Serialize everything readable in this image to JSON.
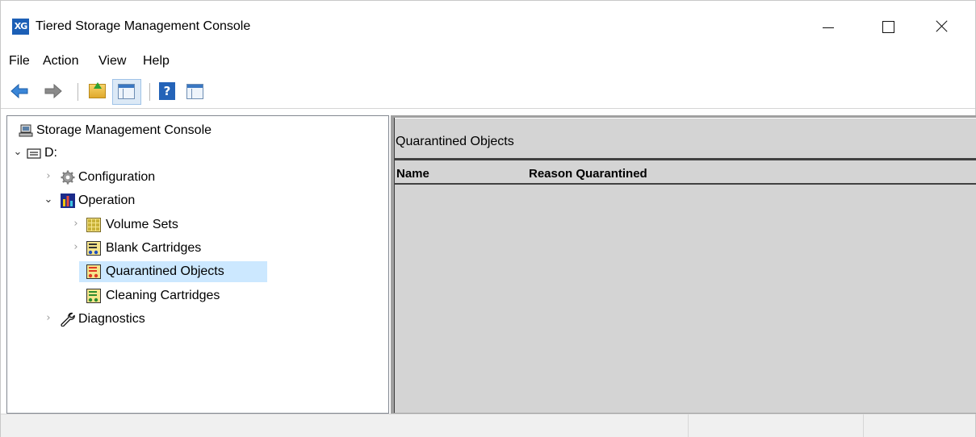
{
  "window": {
    "app_icon_text": "XG",
    "title": "Tiered Storage Management Console"
  },
  "menu": {
    "items": [
      "File",
      "Action",
      "View",
      "Help"
    ]
  },
  "toolbar": {
    "buttons": [
      "back-arrow-icon",
      "forward-arrow-icon",
      "up-one-level-icon",
      "show-hide-console-tree-icon",
      "help-icon",
      "show-hide-action-pane-icon"
    ],
    "help_glyph": "?"
  },
  "tree": {
    "root_label": "Storage Management Console",
    "drive_label": "D:",
    "configuration_label": "Configuration",
    "operation_label": "Operation",
    "volume_sets_label": "Volume Sets",
    "blank_cartridges_label": "Blank Cartridges",
    "quarantined_objects_label": "Quarantined Objects",
    "cleaning_cartridges_label": "Cleaning Cartridges",
    "diagnostics_label": "Diagnostics",
    "selected": "Quarantined Objects"
  },
  "result": {
    "title": "Quarantined Objects",
    "columns": [
      "Name",
      "Reason Quarantined"
    ],
    "rows": []
  },
  "colors": {
    "selection": "#cce8ff",
    "result_background": "#d4d4d4",
    "app_icon": "#1c5fb6"
  }
}
